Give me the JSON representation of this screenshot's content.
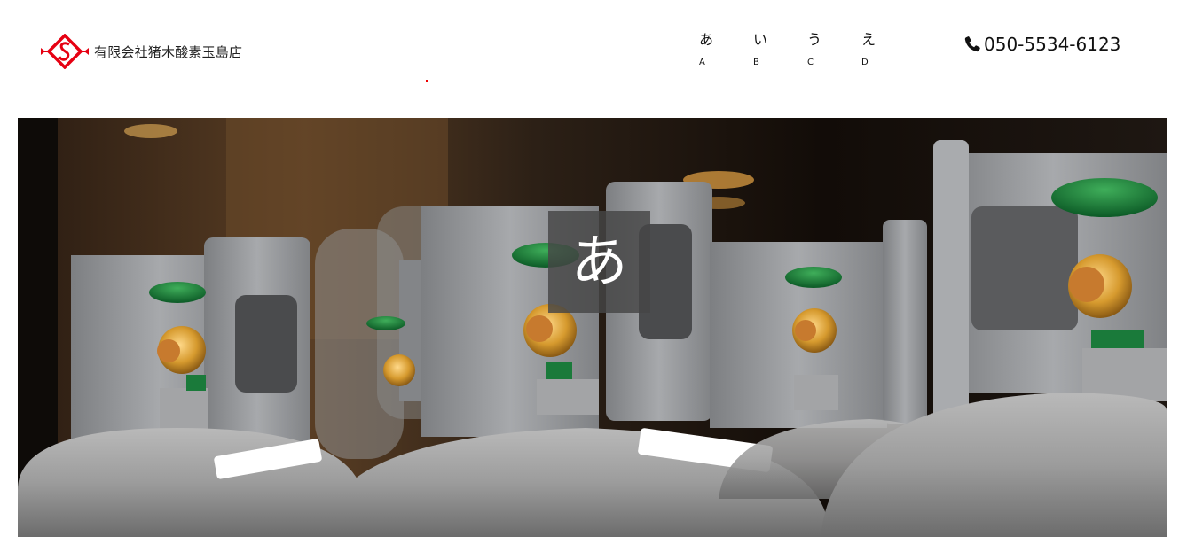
{
  "header": {
    "company_name": "有限会社猪木酸素玉島店",
    "logo_icon": "diamond-s-logo-icon",
    "brand_color": "#e60012"
  },
  "nav": {
    "items": [
      {
        "label_jp": "あ",
        "label_en": "A"
      },
      {
        "label_jp": "い",
        "label_en": "B"
      },
      {
        "label_jp": "う",
        "label_en": "C"
      },
      {
        "label_jp": "え",
        "label_en": "D"
      }
    ]
  },
  "contact": {
    "phone": "050-5534-6123",
    "phone_icon": "phone-icon"
  },
  "hero": {
    "image_subject": "gas-cylinders-photo",
    "badge_text": "あ"
  }
}
